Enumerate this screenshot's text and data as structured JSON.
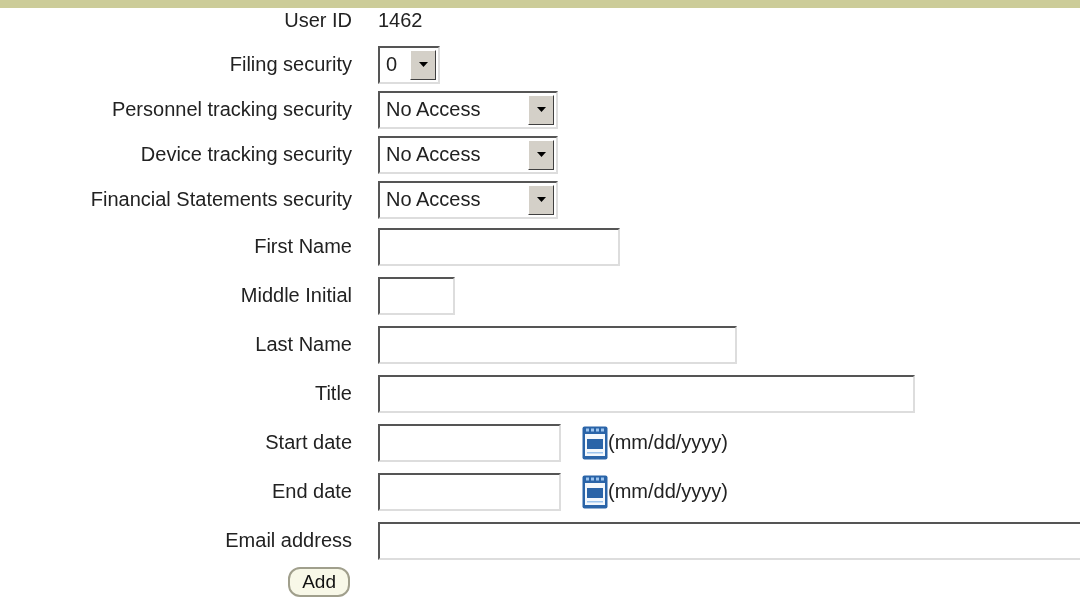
{
  "rows": [
    {
      "kind": "text",
      "label": "User ID",
      "value": "1462"
    },
    {
      "kind": "select",
      "label": "Filing security",
      "value": "0"
    },
    {
      "kind": "select",
      "label": "Personnel tracking security",
      "value": "No Access"
    },
    {
      "kind": "select",
      "label": "Device tracking security",
      "value": "No Access"
    },
    {
      "kind": "select",
      "label": "Financial Statements security",
      "value": "No Access"
    },
    {
      "kind": "input",
      "label": "First Name"
    },
    {
      "kind": "input",
      "label": "Middle Initial"
    },
    {
      "kind": "input",
      "label": "Last Name"
    },
    {
      "kind": "input",
      "label": "Title"
    },
    {
      "kind": "date",
      "label": "Start date",
      "hint": "(mm/dd/yyyy)"
    },
    {
      "kind": "date",
      "label": "End date",
      "hint": "(mm/dd/yyyy)"
    },
    {
      "kind": "input",
      "label": "Email address"
    }
  ],
  "add_button": "Add"
}
